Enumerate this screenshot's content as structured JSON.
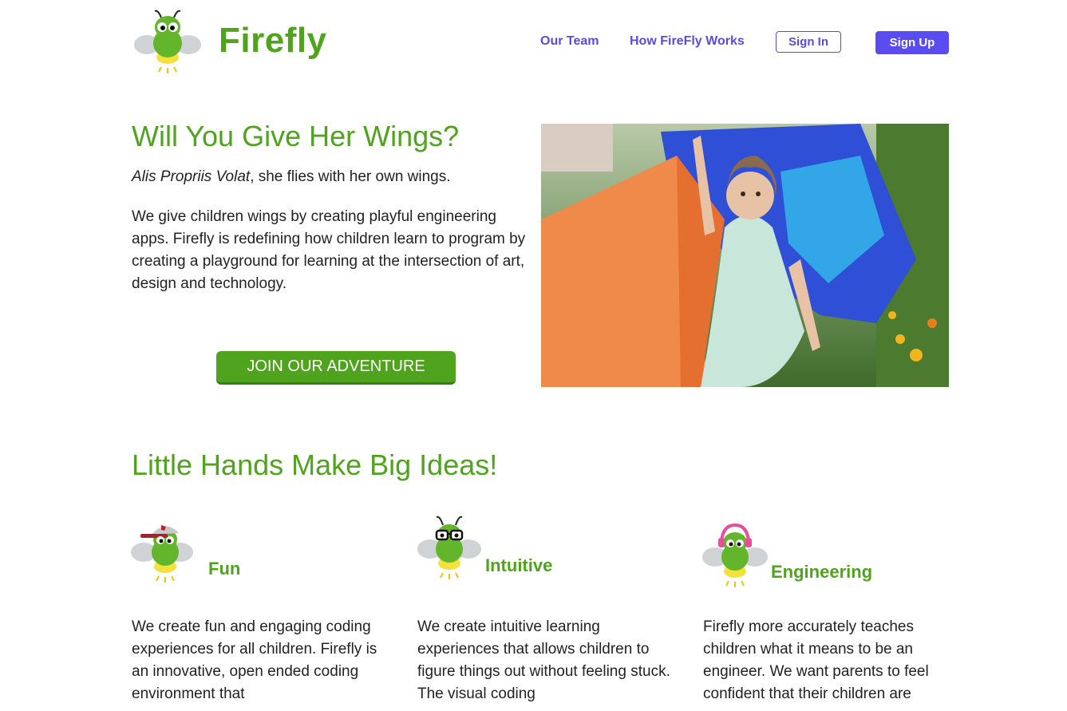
{
  "brand": {
    "name": "Firefly"
  },
  "nav": {
    "our_team": "Our Team",
    "how_it_works": "How FireFly Works",
    "sign_in": "Sign In",
    "sign_up": "Sign Up"
  },
  "hero": {
    "title": "Will You Give Her Wings?",
    "tagline_italic": "Alis Propriis Volat",
    "tagline_rest": ", she flies with her own wings.",
    "description": "We give children wings by creating playful engineering apps. Firefly is redefining how children learn to program by creating a playground for learning at the intersection of art, design and technology.",
    "cta": "JOIN OUR ADVENTURE"
  },
  "features": {
    "title": "Little Hands Make Big Ideas!",
    "items": [
      {
        "title": "Fun",
        "icon": "firefly-cap-icon",
        "text": "We create fun and engaging coding experiences for all children. Firefly is an innovative, open ended coding environment that"
      },
      {
        "title": "Intuitive",
        "icon": "firefly-glasses-icon",
        "text": "We create intuitive learning experiences that allows children to figure things out without feeling stuck. The visual coding"
      },
      {
        "title": "Engineering",
        "icon": "firefly-headphones-icon",
        "text": "Firefly more accurately teaches children what it means to be an engineer. We want parents to feel confident that their children are"
      }
    ]
  },
  "colors": {
    "brand_green": "#4fa31d",
    "nav_purple": "#5a4cdb"
  }
}
